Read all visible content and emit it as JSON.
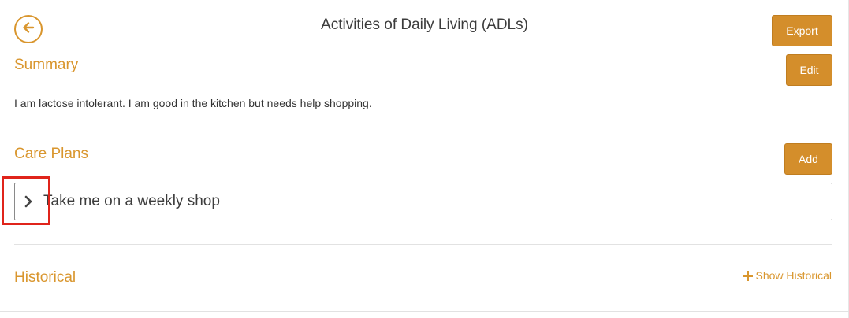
{
  "header": {
    "title": "Activities of Daily Living (ADLs)",
    "export_label": "Export"
  },
  "summary": {
    "heading": "Summary",
    "edit_label": "Edit",
    "text": "I am lactose intolerant. I am good in the kitchen but needs help shopping."
  },
  "care_plans": {
    "heading": "Care Plans",
    "add_label": "Add",
    "items": [
      {
        "label": "Take me on a weekly shop"
      }
    ]
  },
  "historical": {
    "heading": "Historical",
    "show_label": "Show Historical"
  },
  "icons": {
    "back": "arrow-left-icon",
    "expand": "chevron-right-icon",
    "plus": "plus-icon"
  },
  "colors": {
    "accent": "#d9962e",
    "button": "#d48e2b",
    "highlight": "#e0241b"
  }
}
